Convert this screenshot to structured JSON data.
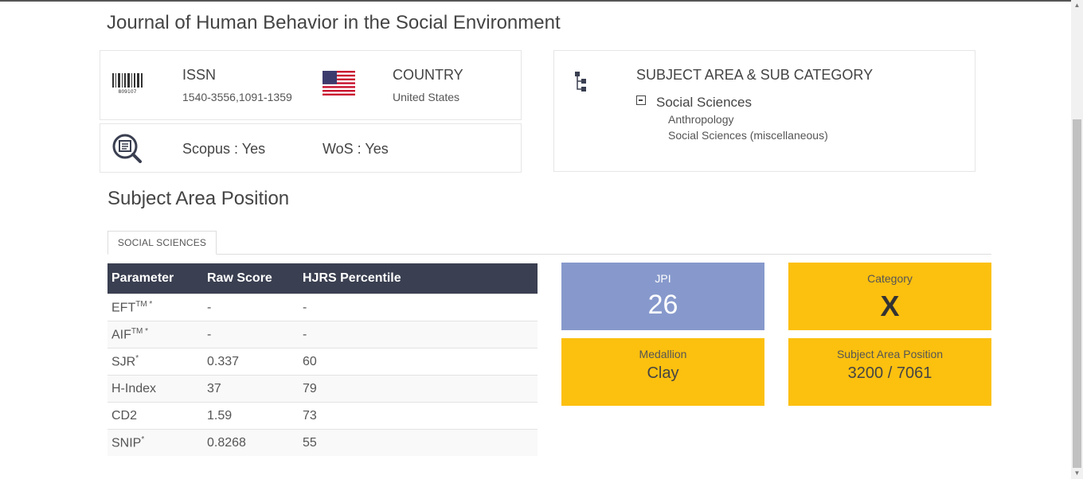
{
  "journal": {
    "title": "Journal of Human Behavior in the Social Environment"
  },
  "issn": {
    "label": "ISSN",
    "value": "1540-3556,1091-1359",
    "icon": "barcode-icon"
  },
  "country": {
    "label": "COUNTRY",
    "value": "United States",
    "icon": "us-flag-icon"
  },
  "indexing": {
    "scopus": "Scopus : Yes",
    "wos": "WoS : Yes",
    "icon": "search-document-icon"
  },
  "subject": {
    "label": "SUBJECT AREA & SUB CATEGORY",
    "area": "Social Sciences",
    "categories": [
      "Anthropology",
      "Social Sciences (miscellaneous)"
    ],
    "icon": "tree-icon"
  },
  "position": {
    "section_title": "Subject Area Position",
    "tab": "SOCIAL SCIENCES"
  },
  "table": {
    "headers": [
      "Parameter",
      "Raw Score",
      "HJRS Percentile"
    ],
    "rows": [
      {
        "name": "EFT",
        "sup": "TM *",
        "raw": "-",
        "pct": "-"
      },
      {
        "name": "AIF",
        "sup": "TM *",
        "raw": "-",
        "pct": "-"
      },
      {
        "name": "SJR",
        "sup": "*",
        "raw": "0.337",
        "pct": "60"
      },
      {
        "name": "H-Index",
        "sup": "",
        "raw": "37",
        "pct": "79"
      },
      {
        "name": "CD2",
        "sup": "",
        "raw": "1.59",
        "pct": "73"
      },
      {
        "name": "SNIP",
        "sup": "*",
        "raw": "0.8268",
        "pct": "55"
      }
    ]
  },
  "stats": {
    "jpi": {
      "label": "JPI",
      "value": "26",
      "color": "#8799cc"
    },
    "category": {
      "label": "Category",
      "value": "X",
      "color": "#fcc00f"
    },
    "medallion": {
      "label": "Medallion",
      "value": "Clay",
      "color": "#fcc00f"
    },
    "subject_position": {
      "label": "Subject Area Position",
      "value": "3200 / 7061",
      "color": "#fcc00f"
    }
  }
}
